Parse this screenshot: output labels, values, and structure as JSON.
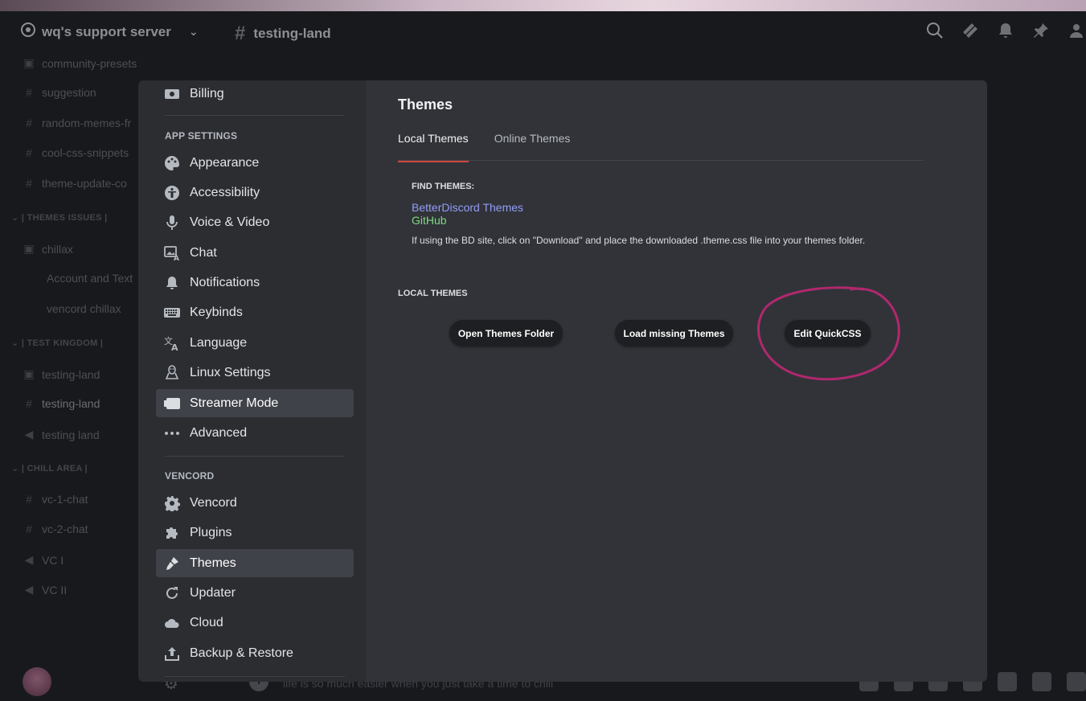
{
  "header": {
    "server_name": "wq's support server",
    "channel_name": "testing-land"
  },
  "background_channels": [
    {
      "label": "community-presets",
      "icon": "forum-icon"
    },
    {
      "label": "suggestion",
      "icon": "hash-icon"
    },
    {
      "label": "random-memes-fr",
      "icon": "hash-icon"
    },
    {
      "label": "cool-css-snippets",
      "icon": "hash-icon"
    },
    {
      "label": "theme-update-co",
      "icon": "hash-icon"
    }
  ],
  "background_sections": [
    {
      "category": "| THEMES ISSUES |",
      "items": [
        "chillax",
        "Account and Text",
        "vencord chillax"
      ]
    },
    {
      "category": "| TEST KINGDOM |",
      "items": [
        "testing-land",
        "testing-land",
        "testing land"
      ]
    },
    {
      "category": "| CHILL AREA |",
      "items": [
        "vc-1-chat",
        "vc-2-chat",
        "VC I",
        "VC II"
      ]
    }
  ],
  "chat_placeholder": "life is so much easier when you just take a time to chill",
  "settings_nav": {
    "billing": "Billing",
    "app_settings_heading": "APP SETTINGS",
    "app_settings": [
      {
        "label": "Appearance",
        "icon": "palette-icon"
      },
      {
        "label": "Accessibility",
        "icon": "accessibility-icon"
      },
      {
        "label": "Voice & Video",
        "icon": "microphone-icon"
      },
      {
        "label": "Chat",
        "icon": "image-text-icon"
      },
      {
        "label": "Notifications",
        "icon": "bell-icon"
      },
      {
        "label": "Keybinds",
        "icon": "keyboard-icon"
      },
      {
        "label": "Language",
        "icon": "translate-icon"
      },
      {
        "label": "Linux Settings",
        "icon": "linux-icon"
      },
      {
        "label": "Streamer Mode",
        "icon": "streamer-icon"
      },
      {
        "label": "Advanced",
        "icon": "ellipsis-icon"
      }
    ],
    "vencord_heading": "VENCORD",
    "vencord": [
      {
        "label": "Vencord",
        "icon": "gear-icon"
      },
      {
        "label": "Plugins",
        "icon": "puzzle-icon"
      },
      {
        "label": "Themes",
        "icon": "brush-icon"
      },
      {
        "label": "Updater",
        "icon": "refresh-icon"
      },
      {
        "label": "Cloud",
        "icon": "cloud-icon"
      },
      {
        "label": "Backup & Restore",
        "icon": "upload-icon"
      }
    ],
    "selected": "Themes"
  },
  "themes": {
    "title": "Themes",
    "tabs": [
      "Local Themes",
      "Online Themes"
    ],
    "active_tab": "Local Themes",
    "find_heading": "FIND THEMES:",
    "link_betterdiscord": "BetterDiscord Themes",
    "link_github": "GitHub",
    "hint": "If using the BD site, click on \"Download\" and place the downloaded .theme.css file into your themes folder.",
    "local_heading": "LOCAL THEMES",
    "buttons": {
      "open_folder": "Open Themes Folder",
      "load_missing": "Load missing Themes",
      "edit_quickcss": "Edit QuickCSS"
    }
  },
  "colors": {
    "accent_tab_underline": "#d0453f",
    "link_blue": "#949cf7",
    "link_green": "#7fd982",
    "annotation": "#b0286e"
  }
}
